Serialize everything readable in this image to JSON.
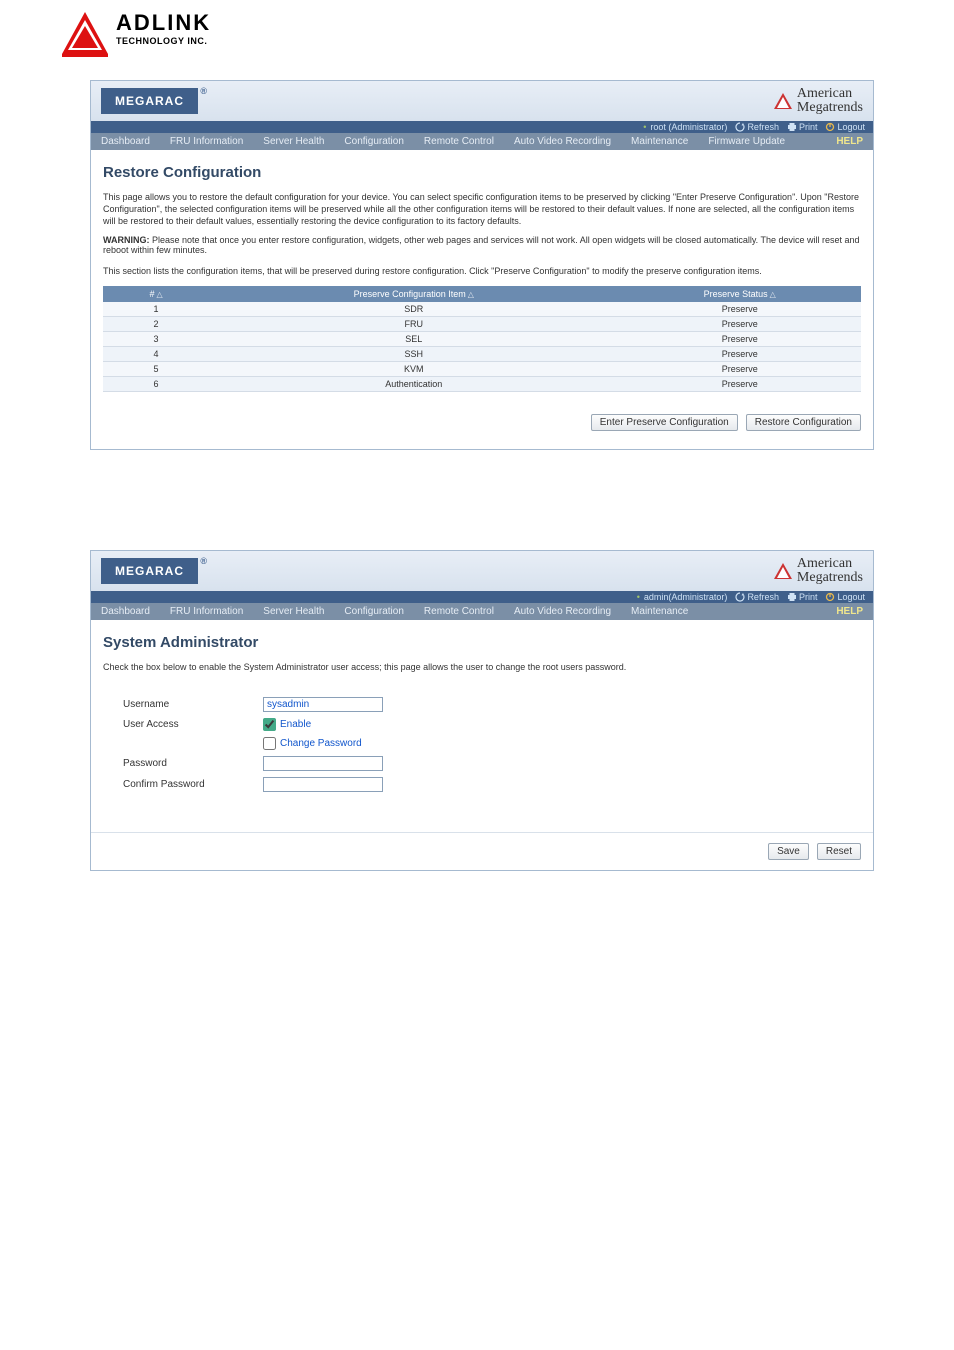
{
  "logo": {
    "brand": "ADLINK",
    "tagline": "TECHNOLOGY INC."
  },
  "frame1": {
    "badge": "MEGARAC",
    "ami": {
      "line1": "American",
      "line2": "Megatrends"
    },
    "userbar": {
      "user": "root (Administrator)",
      "refresh": "Refresh",
      "print": "Print",
      "logout": "Logout"
    },
    "nav": {
      "items": [
        "Dashboard",
        "FRU Information",
        "Server Health",
        "Configuration",
        "Remote Control",
        "Auto Video Recording",
        "Maintenance",
        "Firmware Update"
      ],
      "help": "HELP"
    },
    "title": "Restore Configuration",
    "desc": "This page allows you to restore the default configuration for your device. You can select specific configuration items to be preserved by clicking \"Enter Preserve Configuration\". Upon \"Restore Configuration\", the selected configuration items will be preserved while all the other configuration items will be restored to their default values. If none are selected, all the configuration items will be restored to their default values, essentially restoring the device configuration to its factory defaults.",
    "warn_label": "WARNING:",
    "warn": " Please note that once you enter restore configuration, widgets, other web pages and services will not work. All open widgets will be closed automatically. The device will reset and reboot within few minutes.",
    "section_desc": "This section lists the configuration items, that will be preserved during restore configuration. Click \"Preserve Configuration\" to modify the preserve configuration items.",
    "table": {
      "headers": {
        "num": "#",
        "item": "Preserve Configuration Item",
        "status": "Preserve Status"
      },
      "rows": [
        {
          "n": "1",
          "item": "SDR",
          "status": "Preserve"
        },
        {
          "n": "2",
          "item": "FRU",
          "status": "Preserve"
        },
        {
          "n": "3",
          "item": "SEL",
          "status": "Preserve"
        },
        {
          "n": "4",
          "item": "SSH",
          "status": "Preserve"
        },
        {
          "n": "5",
          "item": "KVM",
          "status": "Preserve"
        },
        {
          "n": "6",
          "item": "Authentication",
          "status": "Preserve"
        }
      ]
    },
    "buttons": {
      "enter": "Enter Preserve Configuration",
      "restore": "Restore Configuration"
    }
  },
  "frame2": {
    "badge": "MEGARAC",
    "ami": {
      "line1": "American",
      "line2": "Megatrends"
    },
    "userbar": {
      "user": "admin(Administrator)",
      "refresh": "Refresh",
      "print": "Print",
      "logout": "Logout"
    },
    "nav": {
      "items": [
        "Dashboard",
        "FRU Information",
        "Server Health",
        "Configuration",
        "Remote Control",
        "Auto Video Recording",
        "Maintenance"
      ],
      "help": "HELP"
    },
    "title": "System Administrator",
    "desc": "Check the box below to enable the System Administrator user access; this page allows the user to change the root users password.",
    "labels": {
      "username": "Username",
      "access": "User Access",
      "enable": "Enable",
      "changepw": "Change Password",
      "password": "Password",
      "confirm": "Confirm Password"
    },
    "values": {
      "username": "sysadmin"
    },
    "buttons": {
      "save": "Save",
      "reset": "Reset"
    }
  }
}
